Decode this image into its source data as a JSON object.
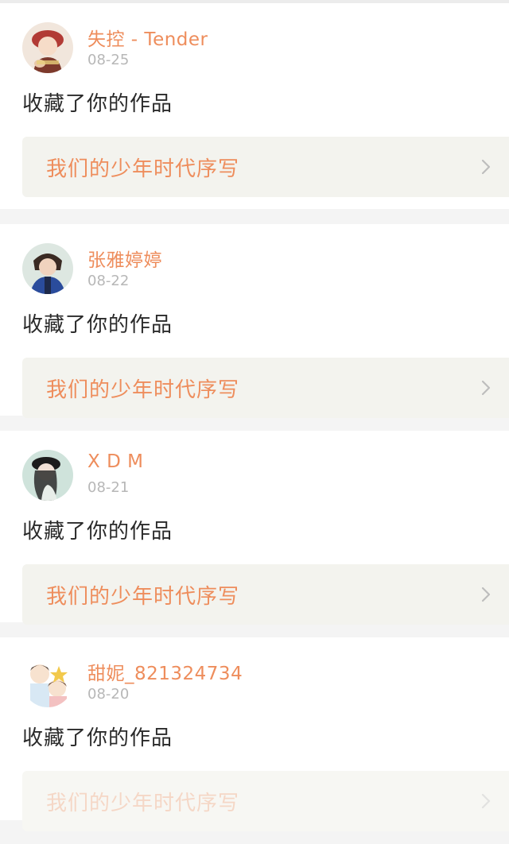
{
  "notifications": [
    {
      "username": "失控 - Tender",
      "date": "08-25",
      "action": "收藏了你的作品",
      "work_title": "我们的少年时代序写",
      "avatar_icon": "avatar-girl-red-hat-icon"
    },
    {
      "username": "张雅婷婷",
      "date": "08-22",
      "action": "收藏了你的作品",
      "work_title": "我们的少年时代序写",
      "avatar_icon": "avatar-boy-blue-jacket-icon"
    },
    {
      "username": "X D M",
      "date": "08-21",
      "action": "收藏了你的作品",
      "work_title": "我们的少年时代序写",
      "avatar_icon": "avatar-girl-black-cap-icon"
    },
    {
      "username": "甜妮_821324734",
      "date": "08-20",
      "action": "收藏了你的作品",
      "work_title": "我们的少年时代序写",
      "avatar_icon": "avatar-cartoon-couple-icon"
    }
  ],
  "colors": {
    "accent": "#ee8d5c",
    "date_gray": "#b7b7b7",
    "card_bg": "#ffffff",
    "link_bg": "#f3f3ee",
    "page_bg": "#f4f4f4"
  }
}
